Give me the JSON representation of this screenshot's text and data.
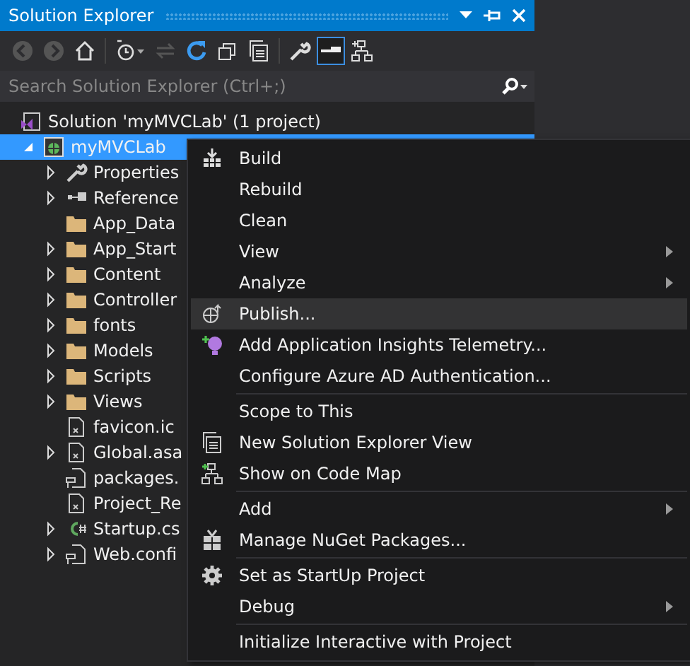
{
  "window": {
    "title": "Solution Explorer"
  },
  "search": {
    "placeholder": "Search Solution Explorer (Ctrl+;)"
  },
  "tree": [
    {
      "label": "Solution 'myMVCLab' (1 project)",
      "selected": false,
      "children": [
        {
          "label": "myMVCLab",
          "selected": true,
          "expanded": true,
          "children": [
            {
              "label": "Properties",
              "kind": "wrench",
              "expandable": true
            },
            {
              "label": "Reference",
              "kind": "references",
              "expandable": true
            },
            {
              "label": "App_Data",
              "kind": "folder",
              "expandable": false
            },
            {
              "label": "App_Start",
              "kind": "folder",
              "expandable": true
            },
            {
              "label": "Content",
              "kind": "folder",
              "expandable": true
            },
            {
              "label": "Controller",
              "kind": "folder",
              "expandable": true
            },
            {
              "label": "fonts",
              "kind": "folder",
              "expandable": true
            },
            {
              "label": "Models",
              "kind": "folder",
              "expandable": true
            },
            {
              "label": "Scripts",
              "kind": "folder",
              "expandable": true
            },
            {
              "label": "Views",
              "kind": "folder",
              "expandable": true
            },
            {
              "label": "favicon.ic",
              "kind": "file",
              "expandable": false
            },
            {
              "label": "Global.asa",
              "kind": "file",
              "expandable": true
            },
            {
              "label": "packages.",
              "kind": "config",
              "expandable": false
            },
            {
              "label": "Project_Re",
              "kind": "file",
              "expandable": false
            },
            {
              "label": "Startup.cs",
              "kind": "csharp",
              "expandable": true
            },
            {
              "label": "Web.confi",
              "kind": "config",
              "expandable": true
            }
          ]
        }
      ]
    }
  ],
  "context_menu": [
    [
      {
        "label": "Build",
        "kind": "build",
        "submenu": false,
        "selected": false
      },
      {
        "label": "Rebuild",
        "submenu": false,
        "selected": false
      },
      {
        "label": "Clean",
        "submenu": false,
        "selected": false
      },
      {
        "label": "View",
        "submenu": true,
        "selected": false
      },
      {
        "label": "Analyze",
        "submenu": true,
        "selected": false
      },
      {
        "label": "Publish...",
        "kind": "globe",
        "submenu": false,
        "selected": true
      },
      {
        "label": "Add Application Insights Telemetry...",
        "kind": "bulb",
        "submenu": false,
        "selected": false
      },
      {
        "label": "Configure Azure AD Authentication...",
        "submenu": false,
        "selected": false
      }
    ],
    [
      {
        "label": "Scope to This",
        "submenu": false,
        "selected": false
      },
      {
        "label": "New Solution Explorer View",
        "kind": "windows",
        "submenu": false,
        "selected": false
      },
      {
        "label": "Show on Code Map",
        "kind": "map",
        "submenu": false,
        "selected": false
      }
    ],
    [
      {
        "label": "Add",
        "submenu": true,
        "selected": false
      },
      {
        "label": "Manage NuGet Packages...",
        "kind": "package",
        "submenu": false,
        "selected": false
      }
    ],
    [
      {
        "label": "Set as StartUp Project",
        "kind": "gear",
        "submenu": false,
        "selected": false
      },
      {
        "label": "Debug",
        "submenu": true,
        "selected": false
      }
    ],
    [
      {
        "label": "Initialize Interactive with Project",
        "submenu": false,
        "selected": false
      }
    ]
  ]
}
